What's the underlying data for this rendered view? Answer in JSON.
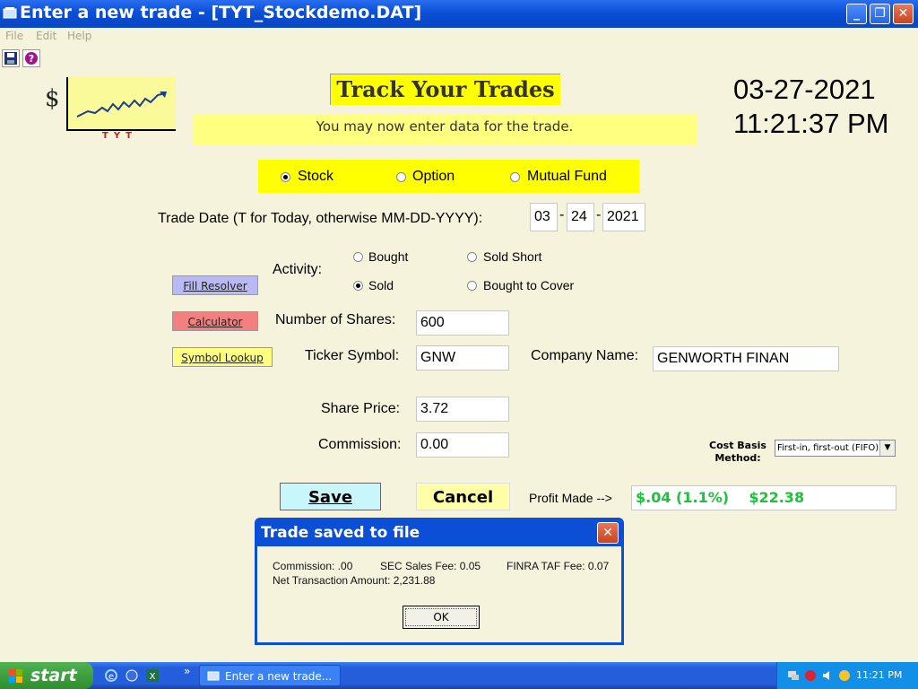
{
  "window": {
    "title": "Enter a new trade - [TYT_Stockdemo.DAT]",
    "minimize": "_",
    "restore": "❐",
    "close": "✕"
  },
  "menu": {
    "file": "File",
    "edit": "Edit",
    "help": "Help"
  },
  "logo": {
    "dollar": "$",
    "tyt": "TYT"
  },
  "header": {
    "title": "Track Your Trades",
    "message": "You may now enter data for the trade.",
    "date": "03-27-2021",
    "time": "11:21:37 PM"
  },
  "type": {
    "options": [
      "Stock",
      "Option",
      "Mutual Fund"
    ],
    "selected": "Stock"
  },
  "trade_date": {
    "label": "Trade Date (T for Today, otherwise MM-DD-YYYY):",
    "month": "03",
    "day": "24",
    "year": "2021",
    "sep": "-"
  },
  "activity": {
    "label": "Activity:",
    "options": [
      "Bought",
      "Sold Short",
      "Sold",
      "Bought to Cover"
    ],
    "selected": "Sold"
  },
  "side_buttons": {
    "fill_resolver": "Fill Resolver",
    "calculator": "Calculator",
    "symbol_lookup": "Symbol Lookup"
  },
  "fields": {
    "shares_label": "Number of Shares:",
    "shares": "600",
    "ticker_label": "Ticker Symbol:",
    "ticker": "GNW",
    "company_label": "Company Name:",
    "company": "GENWORTH FINAN",
    "price_label": "Share Price:",
    "price": "3.72",
    "commission_label": "Commission:",
    "commission": "0.00"
  },
  "cost_basis": {
    "label": "Cost Basis Method:",
    "value": "First-in, first-out (FIFO)"
  },
  "actions": {
    "save": "Save",
    "cancel": "Cancel",
    "profit_label": "Profit Made -->",
    "profit_value": "$.04 (1.1%)    $22.38"
  },
  "dialog": {
    "title": "Trade saved to file",
    "commission": "Commission: .00",
    "sec_fee": "SEC Sales Fee: 0.05",
    "finra_fee": "FINRA TAF Fee: 0.07",
    "net": "Net Transaction Amount: 2,231.88",
    "ok": "OK",
    "close": "✕"
  },
  "taskbar": {
    "start": "start",
    "task": "Enter a new trade...",
    "clock": "11:21 PM",
    "quicklaunch_chevron": "»"
  },
  "colors": {
    "background": "#f6f3dd",
    "yellow": "#ffff00",
    "profit_green": "#1ec23a",
    "titlebar_blue": "#0a4fd6"
  }
}
